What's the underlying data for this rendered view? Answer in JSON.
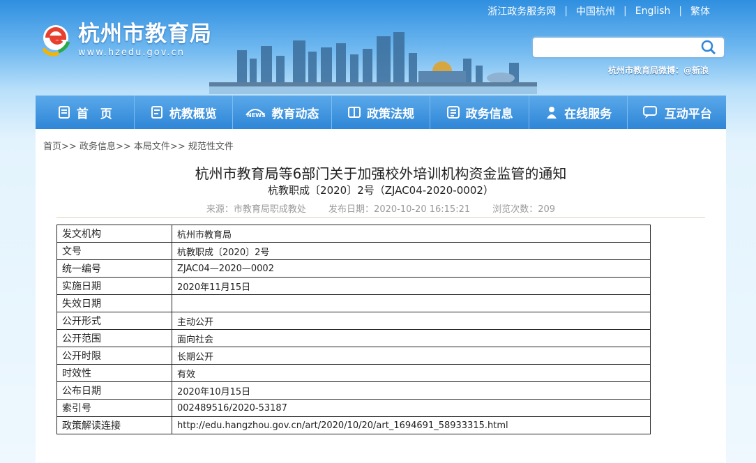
{
  "top_links": [
    "浙江政务服务网",
    "中国杭州",
    "English",
    "繁体"
  ],
  "logo": {
    "name": "杭州市教育局",
    "url": "www.hzedu.gov.cn"
  },
  "search": {
    "placeholder": ""
  },
  "weibo": "杭州市教育局微博：@新浪",
  "nav": [
    {
      "label": "首　页",
      "icon": "home-icon"
    },
    {
      "label": "杭教概览",
      "icon": "document-icon"
    },
    {
      "label": "教育动态",
      "icon": "news-icon"
    },
    {
      "label": "政策法规",
      "icon": "book-icon"
    },
    {
      "label": "政务信息",
      "icon": "list-icon"
    },
    {
      "label": "在线服务",
      "icon": "user-icon"
    },
    {
      "label": "互动平台",
      "icon": "chat-icon"
    }
  ],
  "breadcrumb": [
    "首页",
    "政务信息",
    "本局文件",
    "规范性文件"
  ],
  "breadcrumb_sep": ">>",
  "article": {
    "title": "杭州市教育局等6部门关于加强校外培训机构资金监管的通知",
    "subtitle": "杭教职成〔2020〕2号（ZJAC04-2020-0002）",
    "source": "来源：市教育局职成教处",
    "date": "发布日期：2020-10-20 16:15:21",
    "views": "浏览次数：209"
  },
  "info_table": [
    {
      "key": "发文机构",
      "value": "杭州市教育局"
    },
    {
      "key": "文号",
      "value": "杭教职成〔2020〕2号"
    },
    {
      "key": "统一编号",
      "value": "ZJAC04—2020—0002"
    },
    {
      "key": "实施日期",
      "value": "2020年11月15日"
    },
    {
      "key": "失效日期",
      "value": ""
    },
    {
      "key": "公开形式",
      "value": "主动公开"
    },
    {
      "key": "公开范围",
      "value": "面向社会"
    },
    {
      "key": "公开时限",
      "value": "长期公开"
    },
    {
      "key": "时效性",
      "value": "有效"
    },
    {
      "key": "公布日期",
      "value": "2020年10月15日"
    },
    {
      "key": "索引号",
      "value": "002489516/2020-53187"
    },
    {
      "key": "政策解读连接",
      "value": "http://edu.hangzhou.gov.cn/art/2020/10/20/art_1694691_58933315.html"
    }
  ]
}
